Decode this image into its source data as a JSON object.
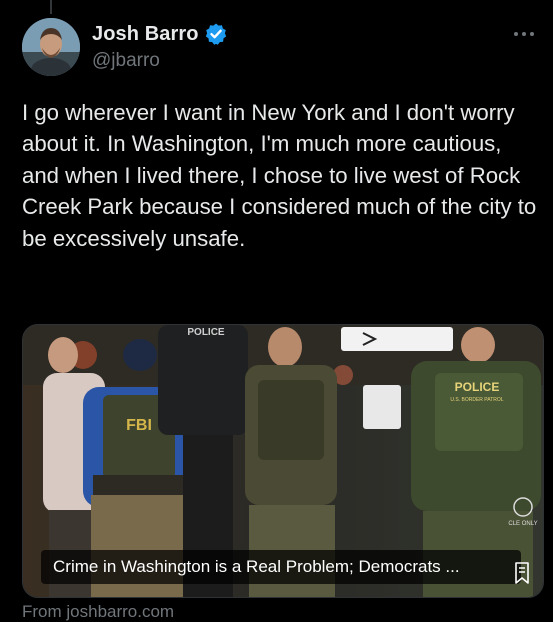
{
  "author": {
    "display_name": "Josh Barro",
    "handle": "@jbarro",
    "verified": true,
    "avatar_icon": "user-avatar"
  },
  "icons": {
    "verified": "verified-badge-icon",
    "more": "more-options-icon",
    "bookmark": "bookmark-icon"
  },
  "tweet": {
    "text": "I go wherever I want in New York and I don't worry about it. In Washington, I'm much more cautious, and when I lived there, I chose to live west of Rock Creek Park because I considered much of the city to be excessively unsafe."
  },
  "card": {
    "caption": "Crime in Washington is a Real Problem; Democrats ...",
    "source": "From joshbarro.com",
    "photo_labels": {
      "fbi": "FBI",
      "police_left": "POLICE",
      "police_right": "POLICE",
      "police_right_sub": "U.S. BORDER PATROL",
      "recycle": "CLE ONLY"
    }
  },
  "colors": {
    "background": "#000000",
    "text_primary": "#e7e9ea",
    "text_secondary": "#71767b",
    "verified_blue": "#1d9bf0",
    "border": "#2f3336"
  }
}
